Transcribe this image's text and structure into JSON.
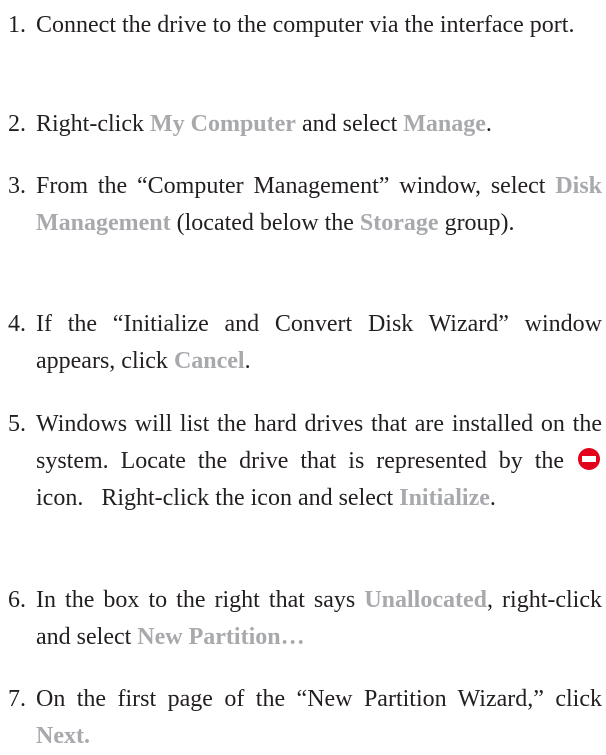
{
  "steps": [
    {
      "number": "1.",
      "parts": [
        "Connect the drive to the computer via the interface port."
      ]
    },
    {
      "number": "2.",
      "parts": [
        "Right-click ",
        "My Computer",
        " and select ",
        "Manage",
        "."
      ]
    },
    {
      "number": "3.",
      "parts": [
        "From the “Computer Management” window, select ",
        "Disk Management",
        " (located below the ",
        "Storage",
        " group)."
      ]
    },
    {
      "number": "4.",
      "parts": [
        "If the “Initialize and Convert Disk Wizard” window appears, click ",
        "Cancel",
        "."
      ]
    },
    {
      "number": "5.",
      "parts": [
        "Windows will list the hard drives that are installed on the system. Locate the drive that is represented by the ",
        " icon.   Right-click the icon and select ",
        "Initialize",
        "."
      ]
    },
    {
      "number": "6.",
      "parts": [
        "In the box to the right that says ",
        "Unallocated",
        ", right-click and select ",
        "New Partition…"
      ]
    },
    {
      "number": "7.",
      "parts": [
        "On the first page of the “New Partition Wizard,” click ",
        "Next."
      ]
    }
  ],
  "colors": {
    "text": "#231f20",
    "highlight": "#a7a9ac",
    "icon_red": "#e3001b"
  },
  "icons": {
    "step5_icon": "disk-not-initialized-icon"
  }
}
